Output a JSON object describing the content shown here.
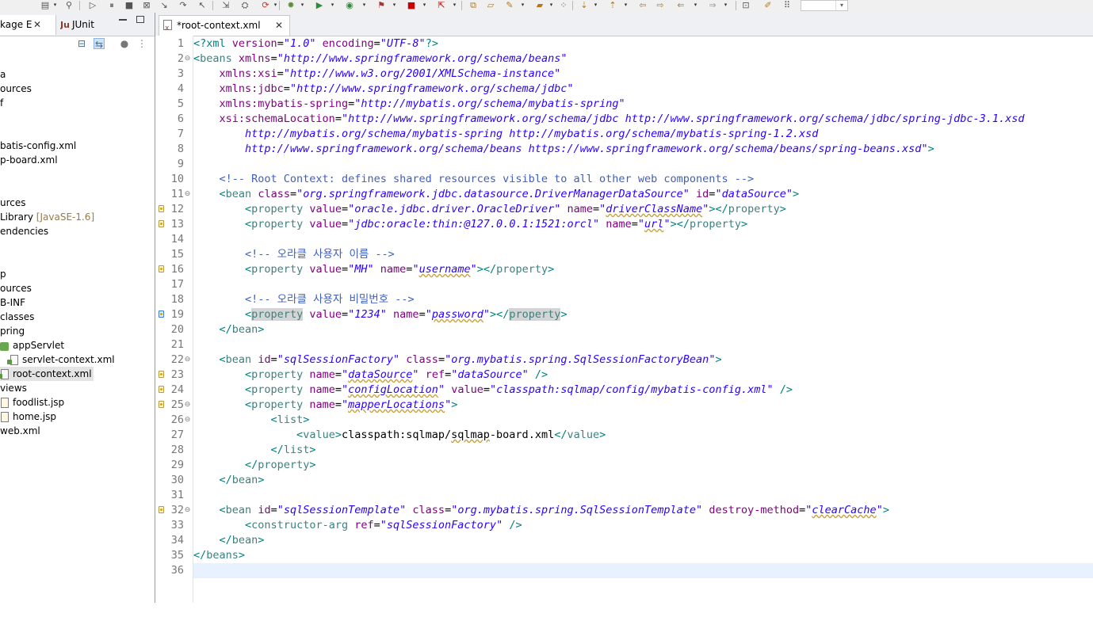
{
  "colors": {
    "pi": "#008080",
    "bracket": "#008080",
    "tag": "#3f7f7f",
    "attr": "#7f007f",
    "value": "#2a00ff",
    "comment": "#3f5fbf",
    "current_line": "#e8f2fe",
    "selection": "#e4e4e4"
  },
  "left_panel": {
    "tabs": [
      {
        "label": "kage E",
        "active": true
      },
      {
        "label": "JUnit",
        "active": false
      }
    ],
    "tree": [
      {
        "text": "a"
      },
      {
        "text": "ources"
      },
      {
        "text": "f"
      },
      {
        "text": "batis-config.xml"
      },
      {
        "text": "p-board.xml"
      },
      {
        "text": "urces"
      },
      {
        "text": "Library",
        "decor": "[JavaSE-1.6]"
      },
      {
        "text": "endencies"
      },
      {
        "text": "p"
      },
      {
        "text": "ources"
      },
      {
        "text": "B-INF"
      },
      {
        "text": "classes"
      },
      {
        "text": "pring"
      },
      {
        "text": "appServlet"
      },
      {
        "text": "servlet-context.xml"
      },
      {
        "text": "root-context.xml",
        "selected": true
      },
      {
        "text": "views"
      },
      {
        "text": "foodlist.jsp"
      },
      {
        "text": "home.jsp"
      },
      {
        "text": "web.xml"
      }
    ]
  },
  "editor": {
    "tab_label": "*root-context.xml",
    "lines": [
      {
        "n": "1",
        "tokens": [
          [
            "pi",
            "<?xml "
          ],
          [
            "attr",
            "version"
          ],
          [
            "txt",
            "="
          ],
          [
            "val",
            "\"1.0\""
          ],
          [
            "txt",
            " "
          ],
          [
            "attr",
            "encoding"
          ],
          [
            "txt",
            "="
          ],
          [
            "val",
            "\"UTF-8\""
          ],
          [
            "pi",
            "?>"
          ]
        ]
      },
      {
        "n": "2",
        "fold": "⊖",
        "tokens": [
          [
            "br",
            "<"
          ],
          [
            "tag",
            "beans"
          ],
          [
            "txt",
            " "
          ],
          [
            "attr",
            "xmlns"
          ],
          [
            "txt",
            "="
          ],
          [
            "val",
            "\"http://www.springframework.org/schema/beans\""
          ]
        ]
      },
      {
        "n": "3",
        "tokens": [
          [
            "txt",
            "    "
          ],
          [
            "attr",
            "xmlns:xsi"
          ],
          [
            "txt",
            "="
          ],
          [
            "val",
            "\"http://www.w3.org/2001/XMLSchema-instance\""
          ]
        ]
      },
      {
        "n": "4",
        "tokens": [
          [
            "txt",
            "    "
          ],
          [
            "attr",
            "xmlns:jdbc"
          ],
          [
            "txt",
            "="
          ],
          [
            "val",
            "\"http://www.springframework.org/schema/jdbc\""
          ]
        ]
      },
      {
        "n": "5",
        "tokens": [
          [
            "txt",
            "    "
          ],
          [
            "attr",
            "xmlns:mybatis-spring"
          ],
          [
            "txt",
            "="
          ],
          [
            "val",
            "\"http://mybatis.org/schema/mybatis-spring\""
          ]
        ]
      },
      {
        "n": "6",
        "tokens": [
          [
            "txt",
            "    "
          ],
          [
            "attr",
            "xsi:schemaLocation"
          ],
          [
            "txt",
            "="
          ],
          [
            "val",
            "\"http://www.springframework.org/schema/jdbc http://www.springframework.org/schema/jdbc/spring-jdbc-3.1.xsd"
          ]
        ]
      },
      {
        "n": "7",
        "tokens": [
          [
            "txt",
            "        "
          ],
          [
            "val",
            "http://mybatis.org/schema/mybatis-spring http://mybatis.org/schema/mybatis-spring-1.2.xsd"
          ]
        ]
      },
      {
        "n": "8",
        "tokens": [
          [
            "txt",
            "        "
          ],
          [
            "val",
            "http://www.springframework.org/schema/beans https://www.springframework.org/schema/beans/spring-beans.xsd\""
          ],
          [
            "br",
            ">"
          ]
        ]
      },
      {
        "n": "9",
        "tokens": []
      },
      {
        "n": "10",
        "tokens": [
          [
            "txt",
            "    "
          ],
          [
            "cmt",
            "<!-- Root Context: defines shared resources visible to all other web components -->"
          ]
        ]
      },
      {
        "n": "11",
        "fold": "⊖",
        "tokens": [
          [
            "txt",
            "    "
          ],
          [
            "br",
            "<"
          ],
          [
            "tag",
            "bean"
          ],
          [
            "txt",
            " "
          ],
          [
            "attr",
            "class"
          ],
          [
            "txt",
            "="
          ],
          [
            "val",
            "\"org.springframework.jdbc.datasource.DriverManagerDataSource\""
          ],
          [
            "txt",
            " "
          ],
          [
            "attr",
            "id"
          ],
          [
            "txt",
            "="
          ],
          [
            "val",
            "\"dataSource\""
          ],
          [
            "br",
            ">"
          ]
        ]
      },
      {
        "n": "12",
        "warn": true,
        "tokens": [
          [
            "txt",
            "        "
          ],
          [
            "br",
            "<"
          ],
          [
            "tag",
            "property"
          ],
          [
            "txt",
            " "
          ],
          [
            "attr",
            "value"
          ],
          [
            "txt",
            "="
          ],
          [
            "val",
            "\"oracle.jdbc.driver.OracleDriver\""
          ],
          [
            "txt",
            " "
          ],
          [
            "attr",
            "name"
          ],
          [
            "txt",
            "="
          ],
          [
            "val",
            "\""
          ],
          [
            "valsp",
            "driverClassName"
          ],
          [
            "val",
            "\""
          ],
          [
            "br",
            "></"
          ],
          [
            "tag",
            "property"
          ],
          [
            "br",
            ">"
          ]
        ]
      },
      {
        "n": "13",
        "warn": true,
        "tokens": [
          [
            "txt",
            "        "
          ],
          [
            "br",
            "<"
          ],
          [
            "tag",
            "property"
          ],
          [
            "txt",
            " "
          ],
          [
            "attr",
            "value"
          ],
          [
            "txt",
            "="
          ],
          [
            "val",
            "\"jdbc:oracle:thin:@127.0.0.1:1521:orcl\""
          ],
          [
            "txt",
            " "
          ],
          [
            "attr",
            "name"
          ],
          [
            "txt",
            "="
          ],
          [
            "val",
            "\""
          ],
          [
            "valsp",
            "url"
          ],
          [
            "val",
            "\""
          ],
          [
            "br",
            "></"
          ],
          [
            "tag",
            "property"
          ],
          [
            "br",
            ">"
          ]
        ]
      },
      {
        "n": "14",
        "tokens": []
      },
      {
        "n": "15",
        "tokens": [
          [
            "txt",
            "        "
          ],
          [
            "cmt",
            "<!-- 오라클 사용자 이름 -->"
          ]
        ]
      },
      {
        "n": "16",
        "warn": true,
        "tokens": [
          [
            "txt",
            "        "
          ],
          [
            "br",
            "<"
          ],
          [
            "tag",
            "property"
          ],
          [
            "txt",
            " "
          ],
          [
            "attr",
            "value"
          ],
          [
            "txt",
            "="
          ],
          [
            "val",
            "\"MH\""
          ],
          [
            "txt",
            " "
          ],
          [
            "attr",
            "name"
          ],
          [
            "txt",
            "="
          ],
          [
            "val",
            "\""
          ],
          [
            "valsp",
            "username"
          ],
          [
            "val",
            "\""
          ],
          [
            "br",
            "></"
          ],
          [
            "tag",
            "property"
          ],
          [
            "br",
            ">"
          ]
        ]
      },
      {
        "n": "17",
        "tokens": []
      },
      {
        "n": "18",
        "tokens": [
          [
            "txt",
            "        "
          ],
          [
            "cmt",
            "<!-- 오라클 사용자 비밀번호 -->"
          ]
        ]
      },
      {
        "n": "19",
        "warn": true,
        "warnsel": true,
        "tokens": [
          [
            "txt",
            "        "
          ],
          [
            "br",
            "<"
          ],
          [
            "taghl",
            "property"
          ],
          [
            "txt",
            " "
          ],
          [
            "attr",
            "value"
          ],
          [
            "txt",
            "="
          ],
          [
            "val",
            "\"1234\""
          ],
          [
            "txt",
            " "
          ],
          [
            "attr",
            "name"
          ],
          [
            "txt",
            "="
          ],
          [
            "val",
            "\""
          ],
          [
            "valsp",
            "password"
          ],
          [
            "val",
            "\""
          ],
          [
            "br",
            "></"
          ],
          [
            "taghl",
            "property"
          ],
          [
            "br",
            ">"
          ]
        ]
      },
      {
        "n": "20",
        "tokens": [
          [
            "txt",
            "    "
          ],
          [
            "br",
            "</"
          ],
          [
            "tag",
            "bean"
          ],
          [
            "br",
            ">"
          ]
        ]
      },
      {
        "n": "21",
        "tokens": []
      },
      {
        "n": "22",
        "fold": "⊖",
        "tokens": [
          [
            "txt",
            "    "
          ],
          [
            "br",
            "<"
          ],
          [
            "tag",
            "bean"
          ],
          [
            "txt",
            " "
          ],
          [
            "attr",
            "id"
          ],
          [
            "txt",
            "="
          ],
          [
            "val",
            "\"sqlSessionFactory\""
          ],
          [
            "txt",
            " "
          ],
          [
            "attr",
            "class"
          ],
          [
            "txt",
            "="
          ],
          [
            "val",
            "\"org.mybatis.spring.SqlSessionFactoryBean\""
          ],
          [
            "br",
            ">"
          ]
        ]
      },
      {
        "n": "23",
        "warn": true,
        "tokens": [
          [
            "txt",
            "        "
          ],
          [
            "br",
            "<"
          ],
          [
            "tag",
            "property"
          ],
          [
            "txt",
            " "
          ],
          [
            "attr",
            "name"
          ],
          [
            "txt",
            "="
          ],
          [
            "val",
            "\""
          ],
          [
            "valsp",
            "dataSource"
          ],
          [
            "val",
            "\""
          ],
          [
            "txt",
            " "
          ],
          [
            "attr",
            "ref"
          ],
          [
            "txt",
            "="
          ],
          [
            "val",
            "\"dataSource\""
          ],
          [
            "txt",
            " "
          ],
          [
            "br",
            "/>"
          ]
        ]
      },
      {
        "n": "24",
        "warn": true,
        "tokens": [
          [
            "txt",
            "        "
          ],
          [
            "br",
            "<"
          ],
          [
            "tag",
            "property"
          ],
          [
            "txt",
            " "
          ],
          [
            "attr",
            "name"
          ],
          [
            "txt",
            "="
          ],
          [
            "val",
            "\""
          ],
          [
            "valsp",
            "configLocation"
          ],
          [
            "val",
            "\""
          ],
          [
            "txt",
            " "
          ],
          [
            "attr",
            "value"
          ],
          [
            "txt",
            "="
          ],
          [
            "val",
            "\"classpath:sqlmap/config/mybatis-config.xml\""
          ],
          [
            "txt",
            " "
          ],
          [
            "br",
            "/>"
          ]
        ]
      },
      {
        "n": "25",
        "warn": true,
        "fold": "⊖",
        "tokens": [
          [
            "txt",
            "        "
          ],
          [
            "br",
            "<"
          ],
          [
            "tag",
            "property"
          ],
          [
            "txt",
            " "
          ],
          [
            "attr",
            "name"
          ],
          [
            "txt",
            "="
          ],
          [
            "val",
            "\""
          ],
          [
            "valsp",
            "mapperLocations"
          ],
          [
            "val",
            "\""
          ],
          [
            "br",
            ">"
          ]
        ]
      },
      {
        "n": "26",
        "fold": "⊖",
        "tokens": [
          [
            "txt",
            "            "
          ],
          [
            "br",
            "<"
          ],
          [
            "tag",
            "list"
          ],
          [
            "br",
            ">"
          ]
        ]
      },
      {
        "n": "27",
        "tokens": [
          [
            "txt",
            "                "
          ],
          [
            "br",
            "<"
          ],
          [
            "tag",
            "value"
          ],
          [
            "br",
            ">"
          ],
          [
            "txt",
            "classpath:sqlmap/"
          ],
          [
            "txtsp",
            "sqlmap"
          ],
          [
            "txt",
            "-board.xml"
          ],
          [
            "br",
            "</"
          ],
          [
            "tag",
            "value"
          ],
          [
            "br",
            ">"
          ]
        ]
      },
      {
        "n": "28",
        "tokens": [
          [
            "txt",
            "            "
          ],
          [
            "br",
            "</"
          ],
          [
            "tag",
            "list"
          ],
          [
            "br",
            ">"
          ]
        ]
      },
      {
        "n": "29",
        "tokens": [
          [
            "txt",
            "        "
          ],
          [
            "br",
            "</"
          ],
          [
            "tag",
            "property"
          ],
          [
            "br",
            ">"
          ]
        ]
      },
      {
        "n": "30",
        "tokens": [
          [
            "txt",
            "    "
          ],
          [
            "br",
            "</"
          ],
          [
            "tag",
            "bean"
          ],
          [
            "br",
            ">"
          ]
        ]
      },
      {
        "n": "31",
        "tokens": []
      },
      {
        "n": "32",
        "warn": true,
        "fold": "⊖",
        "tokens": [
          [
            "txt",
            "    "
          ],
          [
            "br",
            "<"
          ],
          [
            "tag",
            "bean"
          ],
          [
            "txt",
            " "
          ],
          [
            "attr",
            "id"
          ],
          [
            "txt",
            "="
          ],
          [
            "val",
            "\"sqlSessionTemplate\""
          ],
          [
            "txt",
            " "
          ],
          [
            "attr",
            "class"
          ],
          [
            "txt",
            "="
          ],
          [
            "val",
            "\"org.mybatis.spring.SqlSessionTemplate\""
          ],
          [
            "txt",
            " "
          ],
          [
            "attr",
            "destroy-method"
          ],
          [
            "txt",
            "="
          ],
          [
            "val",
            "\""
          ],
          [
            "valsp",
            "clearCache"
          ],
          [
            "val",
            "\""
          ],
          [
            "br",
            ">"
          ]
        ]
      },
      {
        "n": "33",
        "tokens": [
          [
            "txt",
            "        "
          ],
          [
            "br",
            "<"
          ],
          [
            "tag",
            "constructor-arg"
          ],
          [
            "txt",
            " "
          ],
          [
            "attr",
            "ref"
          ],
          [
            "txt",
            "="
          ],
          [
            "val",
            "\"sqlSessionFactory\""
          ],
          [
            "txt",
            " "
          ],
          [
            "br",
            "/>"
          ]
        ]
      },
      {
        "n": "34",
        "tokens": [
          [
            "txt",
            "    "
          ],
          [
            "br",
            "</"
          ],
          [
            "tag",
            "bean"
          ],
          [
            "br",
            ">"
          ]
        ]
      },
      {
        "n": "35",
        "tokens": [
          [
            "br",
            "</"
          ],
          [
            "tag",
            "beans"
          ],
          [
            "br",
            ">"
          ]
        ]
      },
      {
        "n": "36",
        "current": true,
        "tokens": []
      }
    ]
  }
}
